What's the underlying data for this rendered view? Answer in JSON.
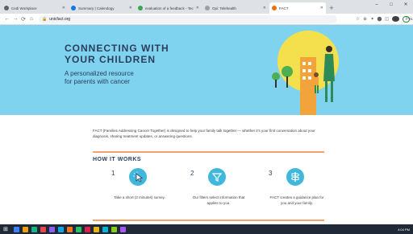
{
  "browser": {
    "tabs": [
      {
        "label": "Cedi Workplace",
        "color": "#5f6368"
      },
      {
        "label": "Summary | Calendogy",
        "color": "#1a73e8"
      },
      {
        "label": "evaluation of a feedback - Tec",
        "color": "#34a853"
      },
      {
        "label": "Opi: Telehealth",
        "color": "#9aa0a6"
      },
      {
        "label": "FACT",
        "color": "#e8710a"
      }
    ],
    "new_tab_label": "+",
    "window_controls": [
      "–",
      "□",
      "✕"
    ],
    "nav": {
      "back": "←",
      "forward": "→",
      "reload": "⟳",
      "home": "⌂"
    },
    "url": "unicfact.org",
    "paused_label": "Paused",
    "ext_icons": [
      "☆",
      "⊕",
      "✦",
      "⬤",
      "◫"
    ]
  },
  "hero": {
    "title": "CONNECTING WITH\nYOUR CHILDREN",
    "subtitle": "A personalized resource\nfor parents with cancer"
  },
  "intro": "FACT (Families Addressing Cancer Together) is designed to help your family talk together — whether it's your first conversation about your diagnosis, sharing treatment updates, or answering questions.",
  "how_it_works": {
    "title": "HOW IT WORKS",
    "steps": [
      {
        "num": "1",
        "icon": "cursor-click-icon",
        "text": "Take a short (2 minutes) survey."
      },
      {
        "num": "2",
        "icon": "funnel-icon",
        "text": "Our filters select information that applies to you."
      },
      {
        "num": "3",
        "icon": "signpost-icon",
        "text": "FACT creates a guidance plan for you and your family."
      }
    ]
  },
  "taskbar": {
    "start_icon": "⊞",
    "apps": [
      "#3b82f6",
      "#f59e0b",
      "#10b981",
      "#ef4444",
      "#8b5cf6",
      "#0ea5e9",
      "#f97316",
      "#22c55e",
      "#e11d48",
      "#eab308",
      "#06b6d4",
      "#84cc16",
      "#a855f7"
    ],
    "tray_text": "4:04 PM"
  },
  "colors": {
    "accent": "#3fb8dc",
    "hero_bg": "#7fd3ef",
    "divider": "#f5a26f",
    "heading": "#2a3e5c"
  }
}
